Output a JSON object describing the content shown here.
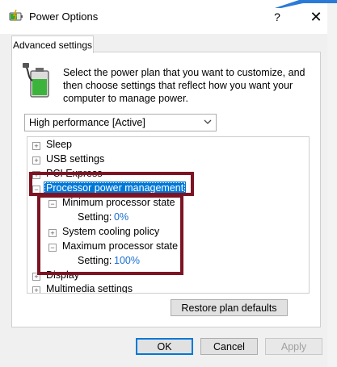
{
  "window": {
    "title": "Power Options",
    "help_glyph": "?",
    "close_glyph": "✕"
  },
  "tab": {
    "label": "Advanced settings"
  },
  "description": "Select the power plan that you want to customize, and then choose settings that reflect how you want your computer to manage power.",
  "plan_select": {
    "value": "High performance [Active]"
  },
  "tree": {
    "items": [
      {
        "label": "Sleep",
        "expander": "+"
      },
      {
        "label": "USB settings",
        "expander": "+"
      },
      {
        "label": "PCI Express",
        "expander": "+"
      },
      {
        "label": "Processor power management",
        "expander": "−",
        "selected": true
      },
      {
        "label": "Minimum processor state",
        "expander": "−"
      },
      {
        "setting_label": "Setting:",
        "setting_value": "0%"
      },
      {
        "label": "System cooling policy",
        "expander": "+"
      },
      {
        "label": "Maximum processor state",
        "expander": "−"
      },
      {
        "setting_label": "Setting:",
        "setting_value": "100%"
      },
      {
        "label": "Display",
        "expander": "+"
      },
      {
        "label": "Multimedia settings",
        "expander": "+"
      }
    ]
  },
  "buttons": {
    "restore": "Restore plan defaults",
    "ok": "OK",
    "cancel": "Cancel",
    "apply": "Apply"
  },
  "colors": {
    "highlight_box": "#7d1424",
    "selection": "#0078d7",
    "value_text": "#1a6fd1"
  }
}
